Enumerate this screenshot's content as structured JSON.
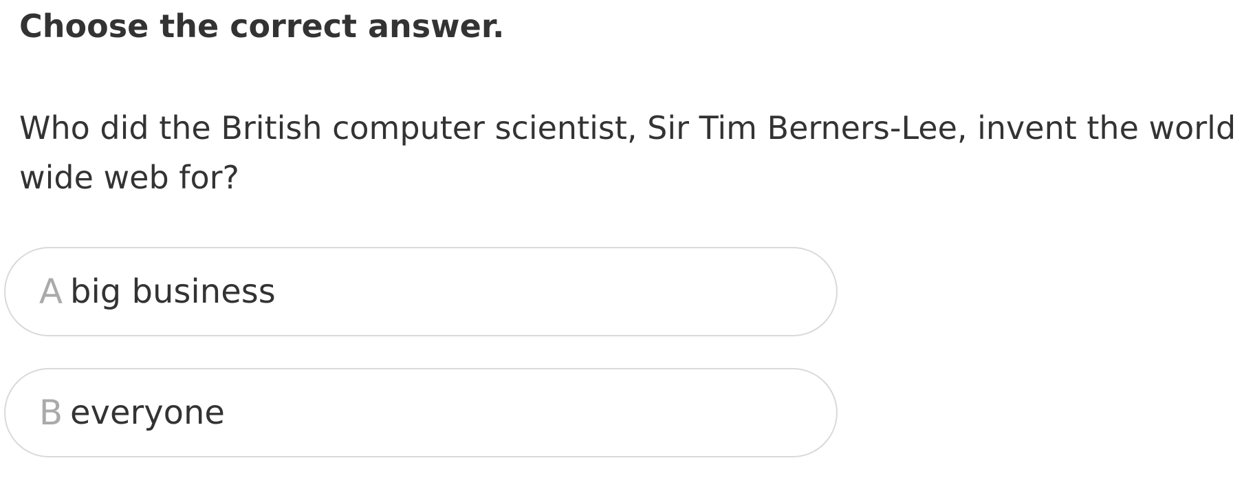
{
  "instruction": "Choose the correct answer.",
  "question": "Who did the British computer scientist, Sir Tim Berners-Lee, invent the world wide web for?",
  "options": [
    {
      "letter": "A",
      "text": "big business"
    },
    {
      "letter": "B",
      "text": "everyone"
    }
  ],
  "colors": {
    "text": "#333333",
    "letter": "#aaaaaa",
    "border": "#d9d9d9",
    "background": "#ffffff"
  }
}
